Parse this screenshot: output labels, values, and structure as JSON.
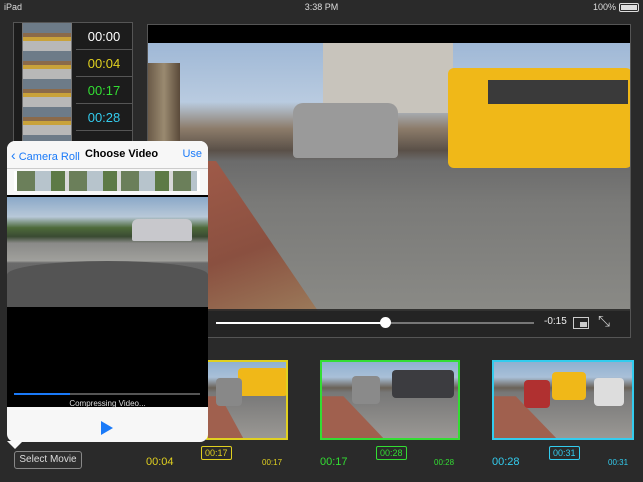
{
  "status_bar": {
    "device": "iPad",
    "time": "3:38 PM",
    "battery": "100%"
  },
  "time_list": [
    {
      "label": "00:00",
      "color": "#ffffff"
    },
    {
      "label": "00:04",
      "color": "#e0d020"
    },
    {
      "label": "00:17",
      "color": "#33dd33"
    },
    {
      "label": "00:28",
      "color": "#33ccee"
    }
  ],
  "player": {
    "remaining": "-0:15",
    "progress": 0.53
  },
  "popover": {
    "back_label": "Camera Roll",
    "title": "Choose Video",
    "use_label": "Use",
    "status": "Compressing Video...",
    "progress": 0.3
  },
  "timeline": {
    "clips": [
      {
        "badge": "00:17",
        "color": "#e0d020",
        "time_left": "00:04",
        "time_right": "00:17"
      },
      {
        "badge": "00:28",
        "color": "#33dd33",
        "time_left": "00:17",
        "time_right": "00:28"
      },
      {
        "badge": "00:31",
        "color": "#33ccee",
        "time_left": "00:28",
        "time_right": "00:31"
      }
    ]
  },
  "select_movie_label": "Select Movie"
}
